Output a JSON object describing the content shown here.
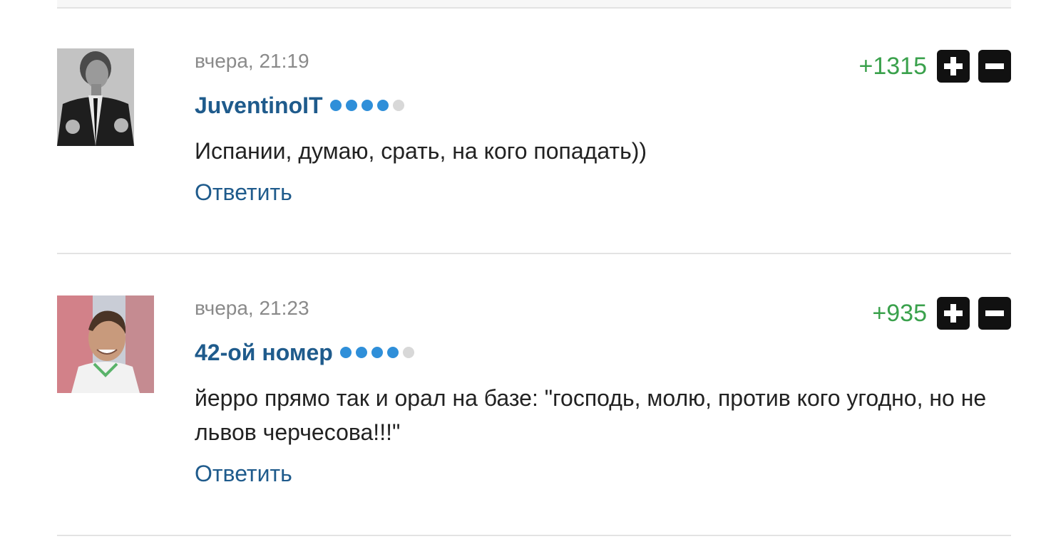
{
  "comments": [
    {
      "timestamp": "вчера, 21:19",
      "author": "JuventinoIT",
      "rating_level": 4,
      "rating_max": 5,
      "text": "Испании, думаю, срать, на кого попадать))",
      "reply_label": "Ответить",
      "score": "+1315"
    },
    {
      "timestamp": "вчера, 21:23",
      "author": "42-ой номер",
      "rating_level": 4,
      "rating_max": 5,
      "text": "йерро прямо так и орал на базе: \"господь, молю, против кого угодно, но не львов черчесова!!!\"",
      "reply_label": "Ответить",
      "score": "+935"
    }
  ],
  "colors": {
    "author": "#1f5b8c",
    "score_positive": "#3aa14c",
    "rating_on": "#2f8fd9",
    "rating_off": "#d8d8d8",
    "vote_button": "#111111"
  },
  "icons": {
    "upvote": "plus-icon",
    "downvote": "minus-icon"
  }
}
